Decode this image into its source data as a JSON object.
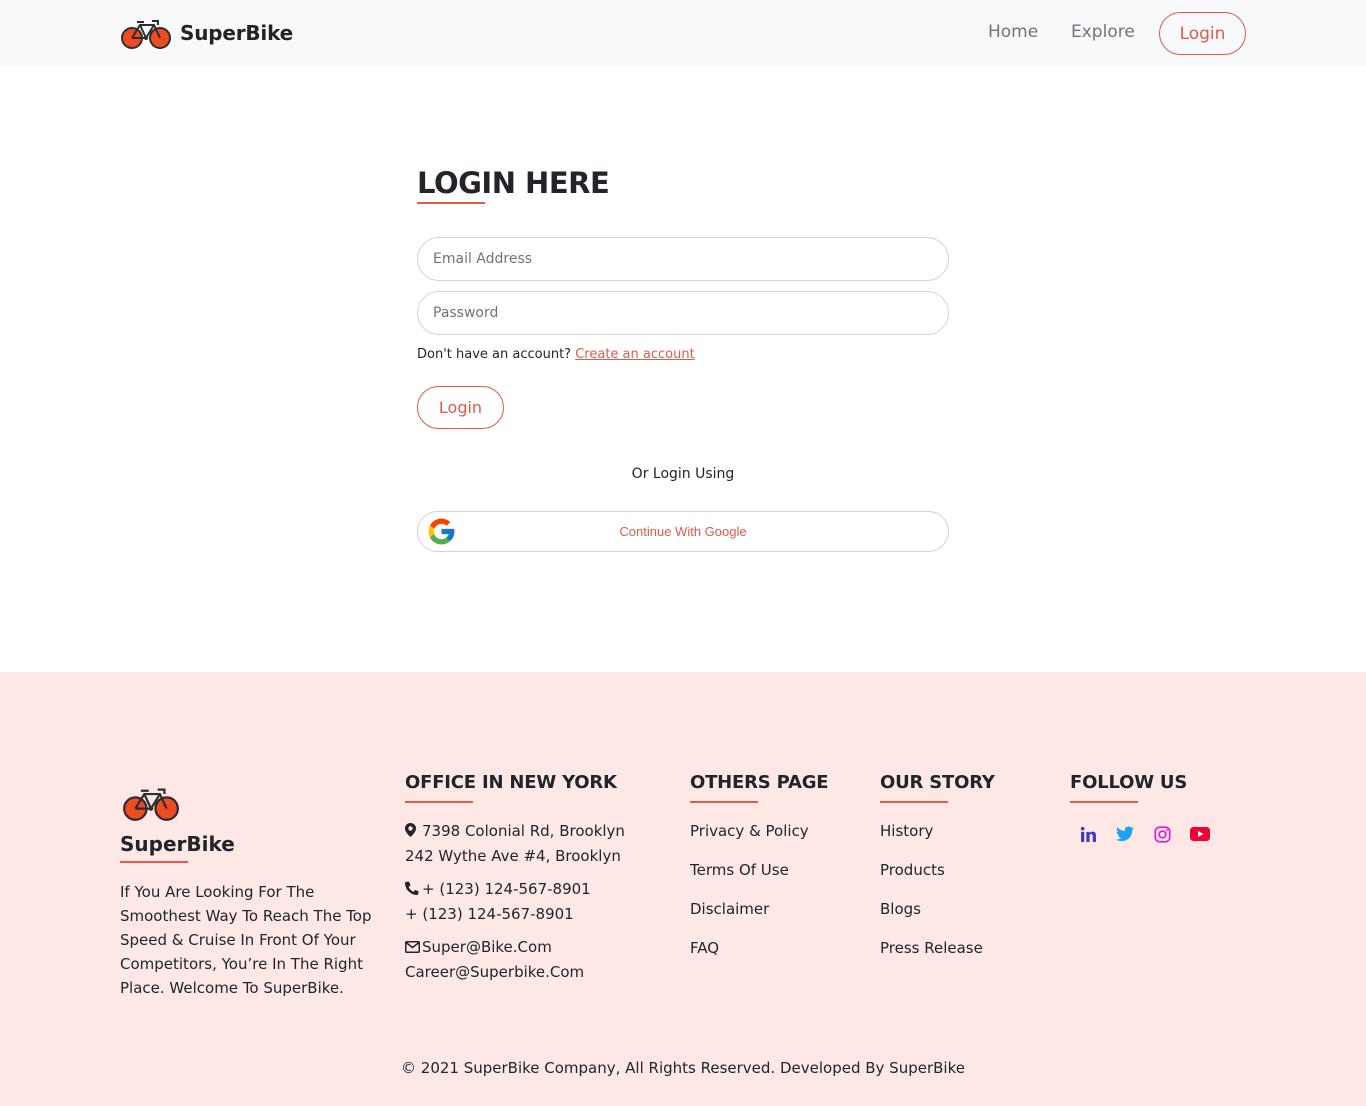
{
  "header": {
    "brand": "SuperBike",
    "nav": {
      "home": "Home",
      "explore": "Explore",
      "login": "Login"
    }
  },
  "login": {
    "title": "LOGIN HERE",
    "email_placeholder": "Email Address",
    "password_placeholder": "Password",
    "account_prompt": "Don't have an account?",
    "create_account_link": "Create an account",
    "login_button": "Login",
    "or_text": "Or Login Using",
    "google_button": "Continue With Google"
  },
  "footer": {
    "brand": "SuperBike",
    "about": "If You Are Looking For The Smoothest Way To Reach The Top Speed & Cruise In Front Of Your Competitors, You’re In The Right Place. Welcome To SuperBike.",
    "office": {
      "heading": "OFFICE IN NEW YORK",
      "address_1": "7398 Colonial Rd, Brooklyn",
      "address_2": "242 Wythe Ave #4, Brooklyn",
      "phone_1": "+ (123) 124-567-8901",
      "phone_2": "+ (123) 124-567-8901",
      "email_1": "Super@Bike.Com",
      "email_2": "Career@Superbike.Com"
    },
    "others": {
      "heading": "OTHERS PAGE",
      "links": [
        "Privacy & Policy",
        "Terms Of Use",
        "Disclaimer",
        "FAQ"
      ]
    },
    "story": {
      "heading": "OUR STORY",
      "links": [
        "History",
        "Products",
        "Blogs",
        "Press Release"
      ]
    },
    "follow": {
      "heading": "FOLLOW US",
      "icons": [
        "linkedin-icon",
        "twitter-icon",
        "instagram-icon",
        "youtube-icon"
      ]
    },
    "copyright": "© 2021 SuperBike Company, All Rights Reserved. Developed By SuperBike"
  },
  "colors": {
    "accent": "#e05a47",
    "header_bg": "#f8f9fa",
    "footer_bg": "#fde8e6",
    "linkedin": "#3b3bc4",
    "twitter": "#1da1f2",
    "instagram": "#e21fd9",
    "youtube": "#ee0033"
  }
}
